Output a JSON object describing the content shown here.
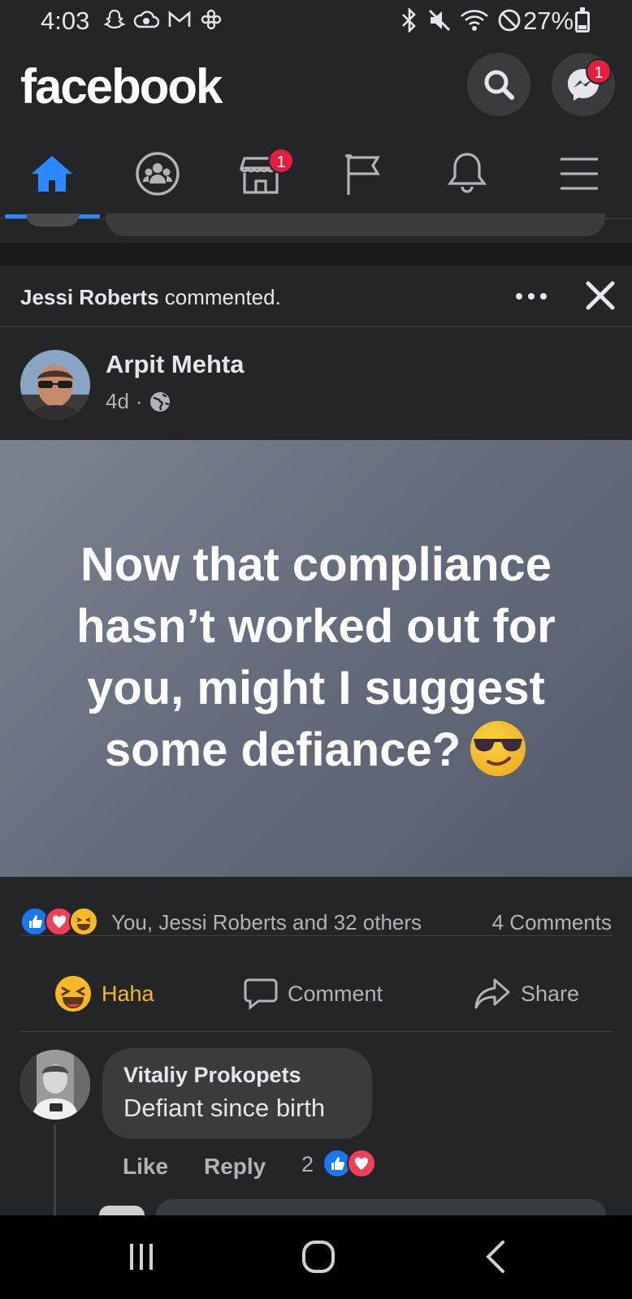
{
  "status_bar": {
    "time": "4:03",
    "battery": "27%",
    "battery_level": 0.27,
    "left_icons": [
      "snapchat-icon",
      "cloud-icon",
      "gmail-icon",
      "settings-snowflake-icon"
    ],
    "right_icons": [
      "bluetooth-icon",
      "mute-icon",
      "wifi-icon",
      "do-not-disturb-icon",
      "battery-icon"
    ]
  },
  "header": {
    "brand": "facebook",
    "messenger_badge": "1"
  },
  "nav": {
    "tabs": [
      {
        "name": "home",
        "icon": "home-icon",
        "active": true
      },
      {
        "name": "groups",
        "icon": "groups-icon",
        "active": false
      },
      {
        "name": "marketplace",
        "icon": "marketplace-icon",
        "active": false,
        "badge": "1"
      },
      {
        "name": "pages",
        "icon": "flag-icon",
        "active": false
      },
      {
        "name": "notifications",
        "icon": "bell-icon",
        "active": false
      },
      {
        "name": "menu",
        "icon": "menu-icon",
        "active": false
      }
    ],
    "accent_color": "#2d88ff"
  },
  "post": {
    "activity_actor": "Jessi Roberts",
    "activity_action": "commented.",
    "author": "Arpit Mehta",
    "age": "4d",
    "separator": "·",
    "text": "Now that compliance hasn’t worked out for you, might I suggest some defiance?",
    "reactions_text": "You, Jessi Roberts and 32 others",
    "comments_count": "4 Comments",
    "actions": {
      "haha": "Haha",
      "comment": "Comment",
      "share": "Share"
    }
  },
  "comment": {
    "author": "Vitaliy Prokopets",
    "text": "Defiant since birth",
    "like": "Like",
    "reply": "Reply",
    "reaction_count": "2"
  }
}
